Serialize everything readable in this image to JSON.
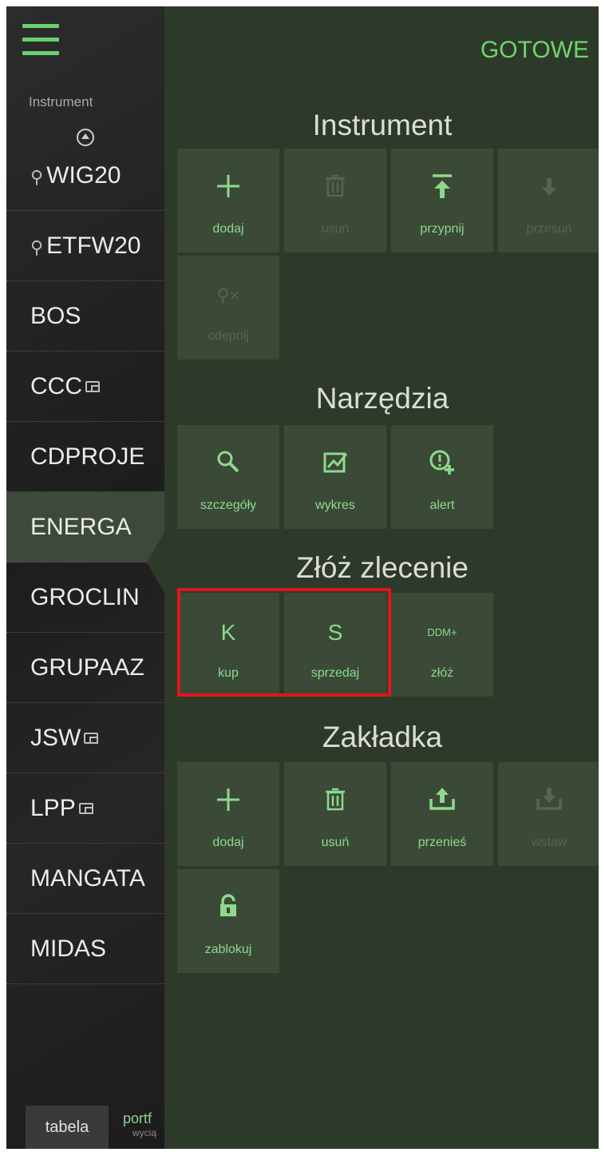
{
  "left_list": {
    "section_label": "Instrument",
    "items": [
      {
        "label": "WIG20",
        "pinned": true,
        "wallet": false,
        "selected": false
      },
      {
        "label": "ETFW20",
        "pinned": true,
        "wallet": false,
        "selected": false
      },
      {
        "label": "BOS",
        "pinned": false,
        "wallet": false,
        "selected": false
      },
      {
        "label": "CCC",
        "pinned": false,
        "wallet": true,
        "selected": false
      },
      {
        "label": "CDPROJE",
        "pinned": false,
        "wallet": false,
        "selected": false
      },
      {
        "label": "ENERGA",
        "pinned": false,
        "wallet": false,
        "selected": true
      },
      {
        "label": "GROCLIN",
        "pinned": false,
        "wallet": false,
        "selected": false
      },
      {
        "label": "GRUPAAZ",
        "pinned": false,
        "wallet": false,
        "selected": false
      },
      {
        "label": "JSW",
        "pinned": false,
        "wallet": true,
        "selected": false
      },
      {
        "label": "LPP",
        "pinned": false,
        "wallet": true,
        "selected": false
      },
      {
        "label": "MANGATA",
        "pinned": false,
        "wallet": false,
        "selected": false
      },
      {
        "label": "MIDAS",
        "pinned": false,
        "wallet": false,
        "selected": false
      }
    ],
    "bottom_tabs": {
      "active": "tabela",
      "inactive_line1": "portf",
      "inactive_line2": "wycią"
    }
  },
  "panel": {
    "done_label": "GOTOWE",
    "groups": [
      {
        "title": "Instrument",
        "tiles": [
          {
            "label": "dodaj",
            "icon": "plus-icon",
            "enabled": true
          },
          {
            "label": "usuń",
            "icon": "trash-icon",
            "enabled": false
          },
          {
            "label": "przypnij",
            "icon": "pin-top-icon",
            "enabled": true
          },
          {
            "label": "przesuń",
            "icon": "arrow-down-icon",
            "enabled": false
          },
          {
            "label": "odepnij",
            "icon": "unpin-icon",
            "enabled": false
          }
        ]
      },
      {
        "title": "Narzędzia",
        "tiles": [
          {
            "label": "szczegóły",
            "icon": "magnifier-icon",
            "enabled": true
          },
          {
            "label": "wykres",
            "icon": "chart-icon",
            "enabled": true
          },
          {
            "label": "alert",
            "icon": "alert-add-icon",
            "enabled": true
          }
        ]
      },
      {
        "title": "Złóż zlecenie",
        "tiles": [
          {
            "label": "kup",
            "glyph": "K",
            "icon": "buy-letter-icon",
            "enabled": true
          },
          {
            "label": "sprzedaj",
            "glyph": "S",
            "icon": "sell-letter-icon",
            "enabled": true
          },
          {
            "label": "złóż",
            "glyph": "DDM+",
            "icon": "ddm-icon",
            "enabled": true
          }
        ]
      },
      {
        "title": "Zakładka",
        "tiles": [
          {
            "label": "dodaj",
            "icon": "plus-icon",
            "enabled": true
          },
          {
            "label": "usuń",
            "icon": "trash-icon",
            "enabled": true
          },
          {
            "label": "przenieś",
            "icon": "upload-icon",
            "enabled": true
          },
          {
            "label": "wstaw",
            "icon": "download-icon",
            "enabled": false
          },
          {
            "label": "zablokuj",
            "icon": "lock-icon",
            "enabled": true
          }
        ]
      }
    ]
  },
  "colors": {
    "accent_green": "#6fd46f",
    "panel_bg": "#2d3a29",
    "tile_bg": "#3a4a36",
    "highlight_red": "#e0161c"
  }
}
